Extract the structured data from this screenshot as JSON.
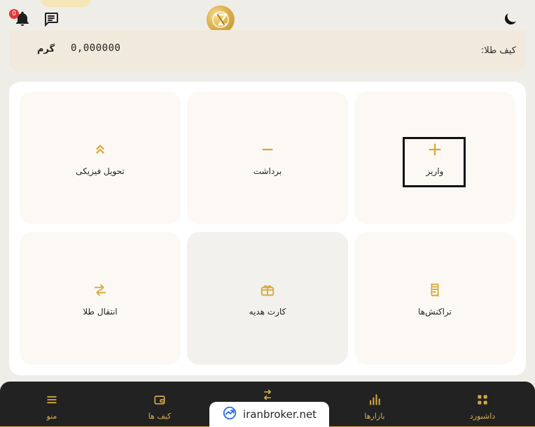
{
  "header": {
    "notification_count": "0"
  },
  "wallet_summary": {
    "label": "کیف طلا:",
    "amount": "0,000000",
    "unit": "گرم"
  },
  "actions": [
    {
      "label": "واریز",
      "icon": "plus-icon"
    },
    {
      "label": "برداشت",
      "icon": "minus-icon"
    },
    {
      "label": "تحویل فیزیکی",
      "icon": "double-chevron-up-icon"
    },
    {
      "label": "تراکنش‌ها",
      "icon": "receipt-icon"
    },
    {
      "label": "کارت هدیه",
      "icon": "gift-card-icon"
    },
    {
      "label": "انتقال طلا",
      "icon": "transfer-arrows-icon"
    }
  ],
  "bottom_nav": [
    {
      "label": "داشبورد",
      "icon": "grid-icon"
    },
    {
      "label": "بازارها",
      "icon": "bar-chart-icon"
    },
    {
      "label": "کیف ها",
      "icon": "wallet-icon"
    },
    {
      "label": "منو",
      "icon": "menu-icon"
    }
  ],
  "watermark": {
    "text": "iranbroker.net"
  },
  "colors": {
    "accent": "#d6ad4d",
    "background": "#efede8",
    "bottom_bar": "#222222"
  }
}
